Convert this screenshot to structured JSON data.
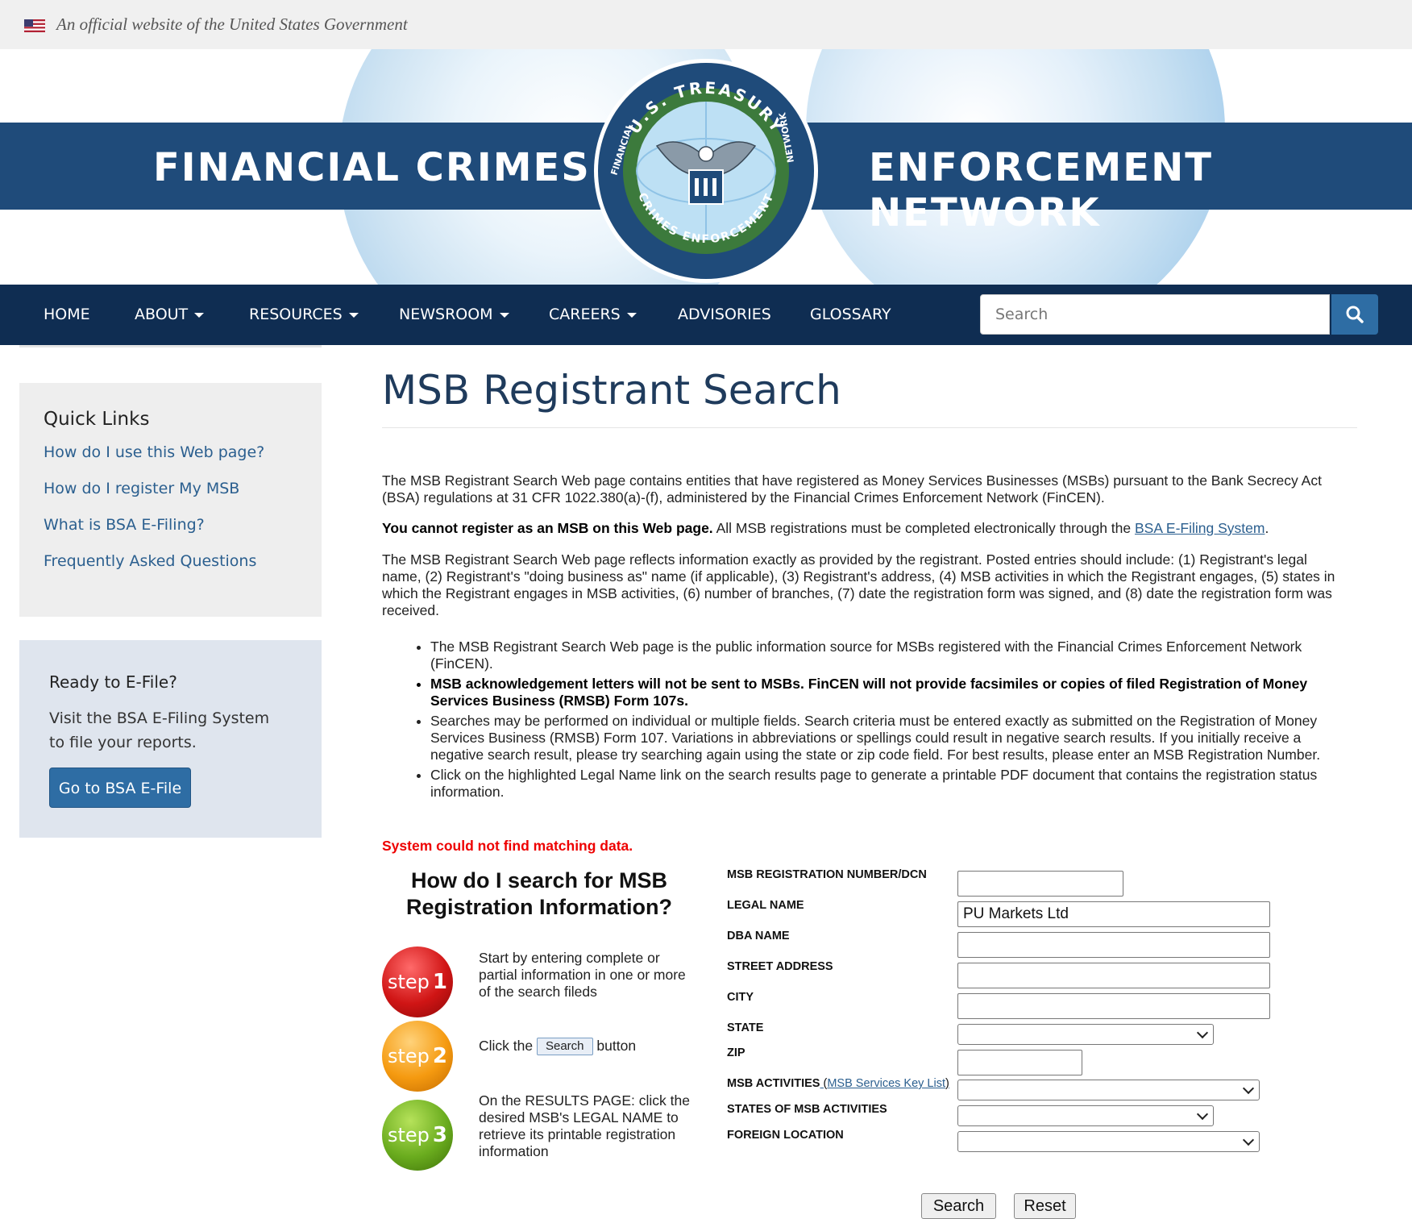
{
  "gov_banner": {
    "text": "An official website of the United States Government",
    "flag_icon": "us-flag-icon"
  },
  "header": {
    "title_left": "FINANCIAL CRIMES",
    "title_right": "ENFORCEMENT NETWORK",
    "seal_top": "U.S. TREASURY",
    "seal_side_left": "FINANCIAL",
    "seal_bottom": "CRIMES ENFORCEMENT",
    "seal_side_right": "NETWORK",
    "colors": {
      "band": "#1f4b7a",
      "nav": "#0f2d52"
    }
  },
  "nav": {
    "items": [
      {
        "label": "HOME",
        "dropdown": false
      },
      {
        "label": "ABOUT",
        "dropdown": true
      },
      {
        "label": "RESOURCES",
        "dropdown": true
      },
      {
        "label": "NEWSROOM",
        "dropdown": true
      },
      {
        "label": "CAREERS",
        "dropdown": true
      },
      {
        "label": "ADVISORIES",
        "dropdown": false
      },
      {
        "label": "GLOSSARY",
        "dropdown": false
      }
    ],
    "search_placeholder": "Search",
    "search_icon": "search-icon"
  },
  "sidebar": {
    "quick_links_title": "Quick Links",
    "links": [
      "How do I use this Web page?",
      "How do I register My MSB",
      "What is BSA E-Filing?",
      "Frequently Asked Questions"
    ],
    "efile_title": "Ready to E-File?",
    "efile_text": "Visit the BSA E-Filing System to file your reports.",
    "efile_button": "Go to BSA E-File"
  },
  "main": {
    "title": "MSB Registrant Search",
    "intro": "The MSB Registrant Search Web page contains entities that have registered as Money Services Businesses (MSBs) pursuant to the Bank Secrecy Act (BSA) regulations at 31 CFR 1022.380(a)-(f), administered by the Financial Crimes Enforcement Network (FinCEN).",
    "notice_bold": "You cannot register as an MSB on this Web page.",
    "notice_text": " All MSB registrations must be completed electronically through the ",
    "notice_link": "BSA E-Filing System",
    "notice_end": ".",
    "reflects": "The MSB Registrant Search Web page reflects information exactly as provided by the registrant. Posted entries should include: (1) Registrant's legal name, (2) Registrant's \"doing business as\" name (if applicable), (3) Registrant's address, (4) MSB activities in which the Registrant engages, (5) states in which the Registrant engages in MSB activities, (6) number of branches, (7) date the registration form was signed, and (8) date the registration form was received.",
    "bullets": [
      "The MSB Registrant Search Web page is the public information source for MSBs registered with the Financial Crimes Enforcement Network (FinCEN).",
      "MSB acknowledgement letters will not be sent to MSBs. FinCEN will not provide facsimiles or copies of filed Registration of Money Services Business (RMSB) Form 107s.",
      "Searches may be performed on individual or multiple fields. Search criteria must be entered exactly as submitted on the Registration of Money Services Business (RMSB) Form 107. Variations in abbreviations or spellings could result in negative search results. If you initially receive a negative search result, please try searching again using the state or zip code field. For best results, please enter an MSB Registration Number.",
      "Click on the highlighted Legal Name link on the search results page to generate a printable PDF document that contains the registration status information."
    ],
    "error": "System could not find matching data."
  },
  "howto": {
    "title": "How do I search for MSB Registration Information?",
    "steps": [
      {
        "word": "step",
        "num": "1",
        "color": "#d01515",
        "text": "Start by entering complete or partial information in one or more of the search fileds"
      },
      {
        "word": "step",
        "num": "2",
        "color": "#f59a10",
        "text_before": "Click the",
        "button": "Search",
        "text_after": "button"
      },
      {
        "word": "step",
        "num": "3",
        "color": "#6aac1e",
        "text": "On the RESULTS PAGE: click the desired MSB's LEGAL NAME to retrieve its printable registration information"
      }
    ]
  },
  "form": {
    "labels": {
      "reg_number": "MSB REGISTRATION NUMBER/DCN",
      "legal_name": "LEGAL NAME",
      "dba_name": "DBA NAME",
      "street": "STREET ADDRESS",
      "city": "CITY",
      "state": "STATE",
      "zip": "ZIP",
      "activities": "MSB ACTIVITIES",
      "activities_paren_open": " (",
      "activities_link": "MSB Services Key List",
      "activities_paren_close": ")",
      "states_activities": "STATES OF MSB ACTIVITIES",
      "foreign": "FOREIGN LOCATION"
    },
    "values": {
      "reg_number": "",
      "legal_name": "PU Markets Ltd",
      "dba_name": "",
      "street": "",
      "city": "",
      "state": "",
      "zip": "",
      "activities": "",
      "states_activities": "",
      "foreign": ""
    },
    "search_button": "Search",
    "reset_button": "Reset"
  }
}
